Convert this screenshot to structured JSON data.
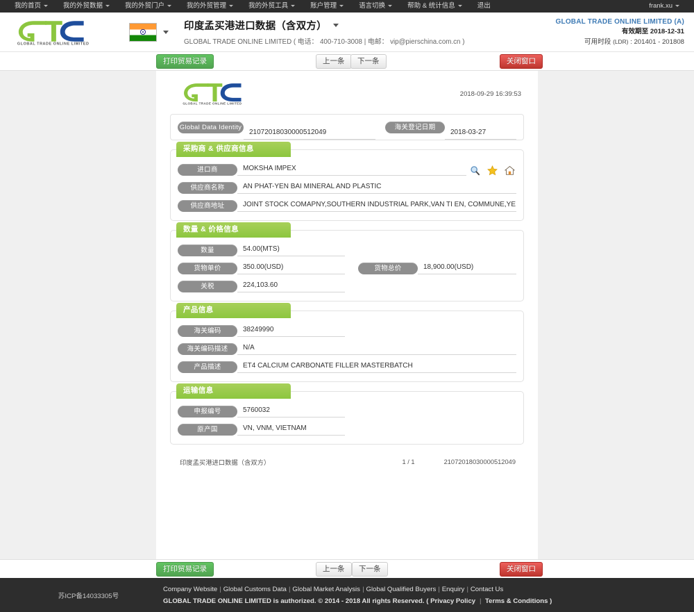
{
  "topnav": {
    "items": [
      {
        "label": "我的首页",
        "caret": true
      },
      {
        "label": "我的外贸数据",
        "caret": true
      },
      {
        "label": "我的外贸门户",
        "caret": true
      },
      {
        "label": "我的外贸管理",
        "caret": true
      },
      {
        "label": "我的外贸工具",
        "caret": true
      },
      {
        "label": "账户管理",
        "caret": true
      },
      {
        "label": "语言切换",
        "caret": true
      },
      {
        "label": "帮助 & 统计信息",
        "caret": true
      },
      {
        "label": "退出",
        "caret": false
      }
    ],
    "user": "frank.xu"
  },
  "header": {
    "logo_text": "GLOBAL TRADE ONLINE LIMITED",
    "flag": "india-flag",
    "page_title": "印度孟买港进口数据（含双方）",
    "company_line": "GLOBAL TRADE ONLINE LIMITED ( 电话： 400-710-3008 | 电邮： vip@pierschina.com.cn )",
    "account_name": "GLOBAL TRADE ONLINE LIMITED (A)",
    "expire_label": "有效期至",
    "expire_value": "2018-12-31",
    "ldr_label": "可用时段",
    "ldr_note": "(LDR)",
    "ldr_value": "201401 - 201808"
  },
  "toolbar": {
    "print_label": "打印贸易记录",
    "prev_label": "上一条",
    "next_label": "下一条",
    "close_label": "关闭窗口"
  },
  "paper": {
    "timestamp": "2018-09-29 16:39:53",
    "identity_label": "Global Data Identity",
    "identity_value": "21072018030000512049",
    "customs_date_label": "海关登记日期",
    "customs_date_value": "2018-03-27",
    "sections": [
      {
        "title": "采购商 & 供应商信息",
        "rows": [
          {
            "label": "进口商",
            "value": "MOKSHA IMPEX",
            "has_icons": true
          },
          {
            "label": "供应商名称",
            "value": "AN PHAT-YEN BAI MINERAL AND PLASTIC"
          },
          {
            "label": "供应商地址",
            "value": "JOINT STOCK COMAPNY,SOUTHERN INDUSTRIAL PARK,VAN TI EN, COMMUNE,YE"
          }
        ]
      },
      {
        "title": "数量 & 价格信息",
        "rows": [
          {
            "label": "数量",
            "value": "54.00(MTS)"
          },
          {
            "label": "货物单价",
            "value": "350.00(USD)",
            "label2": "货物总价",
            "value2": "18,900.00(USD)"
          },
          {
            "label": "关税",
            "value": "224,103.60"
          }
        ]
      },
      {
        "title": "产品信息",
        "rows": [
          {
            "label": "海关编码",
            "value": "38249990"
          },
          {
            "label": "海关编码描述",
            "value": "N/A"
          },
          {
            "label": "产品描述",
            "value": "ET4 CALCIUM CARBONATE FILLER MASTERBATCH"
          }
        ]
      },
      {
        "title": "运输信息",
        "rows": [
          {
            "label": "申报编号",
            "value": "5760032"
          },
          {
            "label": "原产国",
            "value": "VN, VNM, VIETNAM"
          }
        ]
      }
    ],
    "footer_left": "印度孟买港进口数据（含双方）",
    "footer_page": "1 / 1",
    "footer_id": "21072018030000512049"
  },
  "icons": {
    "search": "search-icon",
    "favorite": "star-icon",
    "home": "home-icon"
  },
  "footer": {
    "icp": "苏ICP备14033305号",
    "links": [
      "Company Website",
      "Global Customs Data",
      "Global Market Analysis",
      "Global Qualified Buyers",
      "Enquiry",
      "Contact Us"
    ],
    "copyright": "GLOBAL TRADE ONLINE LIMITED is authorized. © 2014 - 2018 All rights Reserved.",
    "policy_open": "(",
    "privacy": "Privacy Policy",
    "terms": "Terms & Conditions",
    "policy_close": ")"
  },
  "colors": {
    "green": "#8cc63f",
    "blue": "#1f4e9c",
    "dark": "#2d2d2d",
    "pill": "#8e8e8e",
    "accent_link": "#3f7bb5"
  }
}
